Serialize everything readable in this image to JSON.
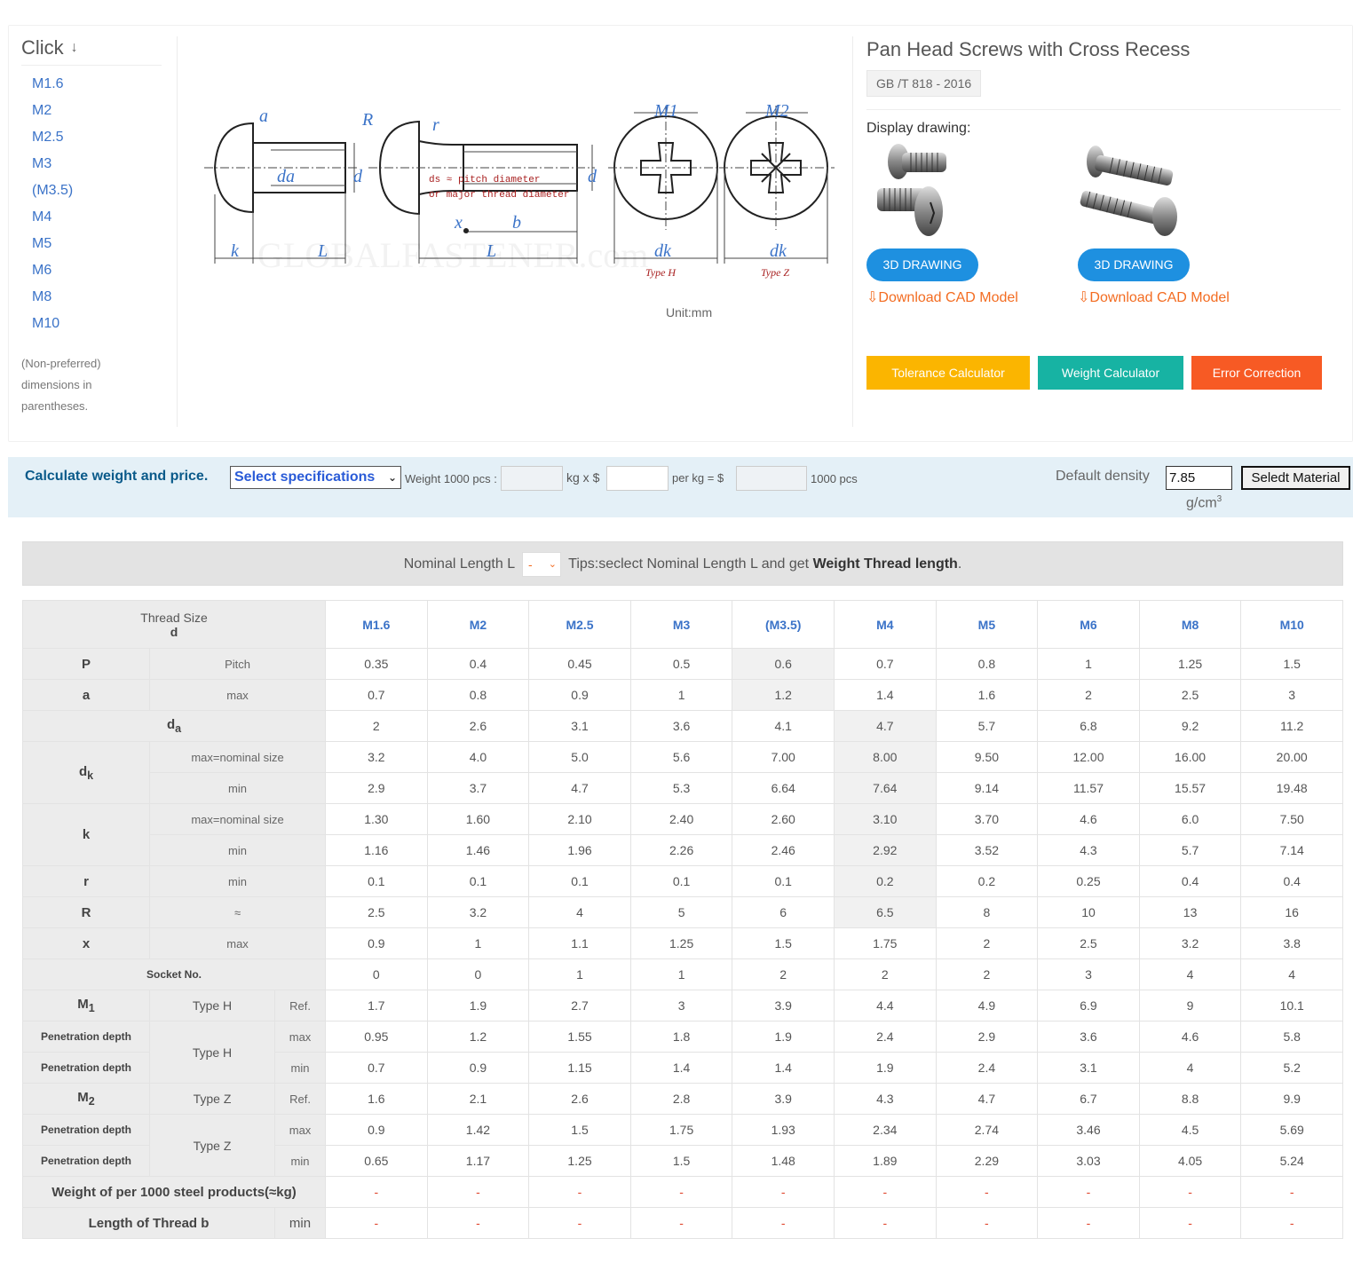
{
  "sidebar": {
    "title": "Click",
    "items": [
      "M1.6",
      "M2",
      "M2.5",
      "M3",
      "(M3.5)",
      "M4",
      "M5",
      "M6",
      "M8",
      "M10"
    ],
    "note": "(Non-preferred) dimensions in parentheses."
  },
  "drawing": {
    "unit": "Unit:mm",
    "labels": {
      "a": "a",
      "R": "R",
      "r": "r",
      "M1": "M1",
      "M2": "M2",
      "da": "da",
      "d": "d",
      "k": "k",
      "L": "L",
      "b": "b",
      "x": "x",
      "dk": "dk",
      "type_h": "Type H",
      "type_z": "Type Z",
      "ds_note_1": "ds ≈ pitch diameter",
      "ds_note_2": "or major thread diameter",
      "watermark": "GLOBALFASTENER.com"
    }
  },
  "product": {
    "title": "Pan Head Screws with Cross Recess",
    "standard": "GB /T 818 - 2016",
    "display_drawing": "Display drawing:",
    "btn_3d": "3D DRAWING",
    "download": "Download CAD Model",
    "tolerance": "Tolerance Calculator",
    "weight": "Weight Calculator",
    "error": "Error Correction"
  },
  "colors": {
    "tolerance": "#fbb500",
    "weight": "#17b3a3",
    "error": "#f75a24",
    "btn3d": "#1e90e0",
    "link": "#3b73c8",
    "download": "#f36c21"
  },
  "calc": {
    "label": "Calculate weight and price.",
    "select": "Select specifications",
    "weight_label": "Weight 1000 pcs :",
    "kg_x": "kg x $",
    "per_kg": "per kg = $",
    "pcs": "1000 pcs",
    "density_label": "Default density",
    "density_value": "7.85",
    "material_btn": "Seledt Material",
    "density_unit": "g/cm",
    "density_unit_sup": "3"
  },
  "nominal": {
    "label": "Nominal Length L",
    "value": "-",
    "tips": "Tips:seclect Nominal Length L and get",
    "tips_bold": "Weight Thread length",
    "tips_end": "."
  },
  "table": {
    "thread_size_label": "Thread Size",
    "thread_size_sub": "d",
    "sizes": [
      "M1.6",
      "M2",
      "M2.5",
      "M3",
      "(M3.5)",
      "M4",
      "M5",
      "M6",
      "M8",
      "M10"
    ],
    "rows": {
      "P": {
        "label": "P",
        "sub": "Pitch",
        "values": [
          "0.35",
          "0.4",
          "0.45",
          "0.5",
          "0.6",
          "0.7",
          "0.8",
          "1",
          "1.25",
          "1.5"
        ]
      },
      "a": {
        "label": "a",
        "sub": "max",
        "values": [
          "0.7",
          "0.8",
          "0.9",
          "1",
          "1.2",
          "1.4",
          "1.6",
          "2",
          "2.5",
          "3"
        ]
      },
      "da": {
        "label": "d",
        "label_sub": "a",
        "values": [
          "2",
          "2.6",
          "3.1",
          "3.6",
          "4.1",
          "4.7",
          "5.7",
          "6.8",
          "9.2",
          "11.2"
        ]
      },
      "dk_max": {
        "label": "d",
        "label_sub": "k",
        "sub": "max=nominal size",
        "values": [
          "3.2",
          "4.0",
          "5.0",
          "5.6",
          "7.00",
          "8.00",
          "9.50",
          "12.00",
          "16.00",
          "20.00"
        ]
      },
      "dk_min": {
        "sub": "min",
        "values": [
          "2.9",
          "3.7",
          "4.7",
          "5.3",
          "6.64",
          "7.64",
          "9.14",
          "11.57",
          "15.57",
          "19.48"
        ]
      },
      "k_max": {
        "label": "k",
        "sub": "max=nominal size",
        "values": [
          "1.30",
          "1.60",
          "2.10",
          "2.40",
          "2.60",
          "3.10",
          "3.70",
          "4.6",
          "6.0",
          "7.50"
        ]
      },
      "k_min": {
        "sub": "min",
        "values": [
          "1.16",
          "1.46",
          "1.96",
          "2.26",
          "2.46",
          "2.92",
          "3.52",
          "4.3",
          "5.7",
          "7.14"
        ]
      },
      "r": {
        "label": "r",
        "sub": "min",
        "values": [
          "0.1",
          "0.1",
          "0.1",
          "0.1",
          "0.1",
          "0.2",
          "0.2",
          "0.25",
          "0.4",
          "0.4"
        ]
      },
      "R": {
        "label": "R",
        "sub": "≈",
        "values": [
          "2.5",
          "3.2",
          "4",
          "5",
          "6",
          "6.5",
          "8",
          "10",
          "13",
          "16"
        ]
      },
      "x": {
        "label": "x",
        "sub": "max",
        "values": [
          "0.9",
          "1",
          "1.1",
          "1.25",
          "1.5",
          "1.75",
          "2",
          "2.5",
          "3.2",
          "3.8"
        ]
      },
      "socket": {
        "label": "Socket No.",
        "values": [
          "0",
          "0",
          "1",
          "1",
          "2",
          "2",
          "2",
          "3",
          "4",
          "4"
        ]
      },
      "M1": {
        "label": "M",
        "label_sub": "1",
        "type": "Type H",
        "ref": "Ref.",
        "values": [
          "1.7",
          "1.9",
          "2.7",
          "3",
          "3.9",
          "4.4",
          "4.9",
          "6.9",
          "9",
          "10.1"
        ]
      },
      "pen_h_max": {
        "label": "Penetration depth",
        "type": "Type H",
        "sub": "max",
        "values": [
          "0.95",
          "1.2",
          "1.55",
          "1.8",
          "1.9",
          "2.4",
          "2.9",
          "3.6",
          "4.6",
          "5.8"
        ]
      },
      "pen_h_min": {
        "label": "Penetration depth",
        "sub": "min",
        "values": [
          "0.7",
          "0.9",
          "1.15",
          "1.4",
          "1.4",
          "1.9",
          "2.4",
          "3.1",
          "4",
          "5.2"
        ]
      },
      "M2": {
        "label": "M",
        "label_sub": "2",
        "type": "Type Z",
        "ref": "Ref.",
        "values": [
          "1.6",
          "2.1",
          "2.6",
          "2.8",
          "3.9",
          "4.3",
          "4.7",
          "6.7",
          "8.8",
          "9.9"
        ]
      },
      "pen_z_max": {
        "label": "Penetration depth",
        "type": "Type Z",
        "sub": "max",
        "values": [
          "0.9",
          "1.42",
          "1.5",
          "1.75",
          "1.93",
          "2.34",
          "2.74",
          "3.46",
          "4.5",
          "5.69"
        ]
      },
      "pen_z_min": {
        "label": "Penetration depth",
        "sub": "min",
        "values": [
          "0.65",
          "1.17",
          "1.25",
          "1.5",
          "1.48",
          "1.89",
          "2.29",
          "3.03",
          "4.05",
          "5.24"
        ]
      },
      "weight": {
        "label": "Weight of per 1000 steel products(≈kg)",
        "values": [
          "-",
          "-",
          "-",
          "-",
          "-",
          "-",
          "-",
          "-",
          "-",
          "-"
        ]
      },
      "thread": {
        "label": "Length of Thread b",
        "sub": "min",
        "values": [
          "-",
          "-",
          "-",
          "-",
          "-",
          "-",
          "-",
          "-",
          "-",
          "-"
        ]
      }
    }
  }
}
